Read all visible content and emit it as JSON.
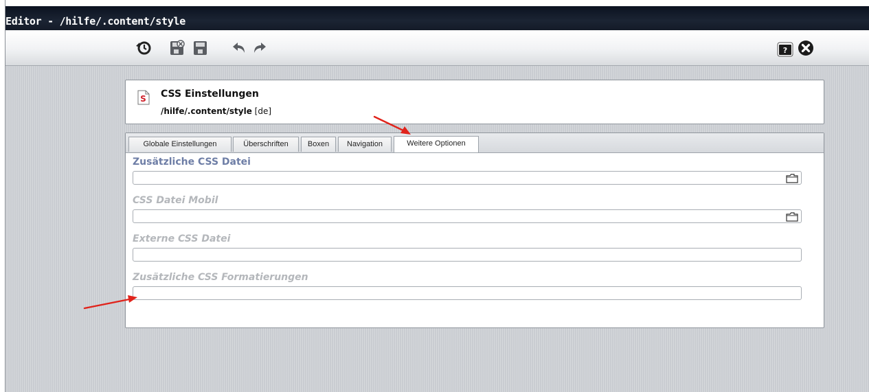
{
  "window": {
    "title": "Editor - /hilfe/.content/style"
  },
  "toolbar": {
    "left_icons": [
      "history-icon",
      "save-exit-icon",
      "save-icon",
      "undo-icon",
      "redo-icon"
    ],
    "right_icons": [
      "help-icon",
      "close-icon"
    ]
  },
  "header": {
    "title": "CSS Einstellungen",
    "path": "/hilfe/.content/style",
    "locale": "[de]",
    "icon_letter": "S"
  },
  "tabs": [
    {
      "label": "Globale Einstellungen",
      "active": false
    },
    {
      "label": "Überschriften",
      "active": false
    },
    {
      "label": "Boxen",
      "active": false
    },
    {
      "label": "Navigation",
      "active": false
    },
    {
      "label": "Weitere Optionen",
      "active": true
    }
  ],
  "fields": [
    {
      "label": "Zusätzliche CSS Datei",
      "value": "",
      "active": true,
      "has_file_picker": true
    },
    {
      "label": "CSS Datei Mobil",
      "value": "",
      "active": false,
      "has_file_picker": true
    },
    {
      "label": "Externe CSS Datei",
      "value": "",
      "active": false,
      "has_file_picker": false
    },
    {
      "label": "Zusätzliche CSS Formatierungen",
      "value": "",
      "active": false,
      "has_file_picker": false
    }
  ],
  "colors": {
    "annotation_arrow": "#e0231b",
    "active_label": "#6e7ea6",
    "inactive_label": "#b4b7bb",
    "titlebar": "#141b28"
  }
}
